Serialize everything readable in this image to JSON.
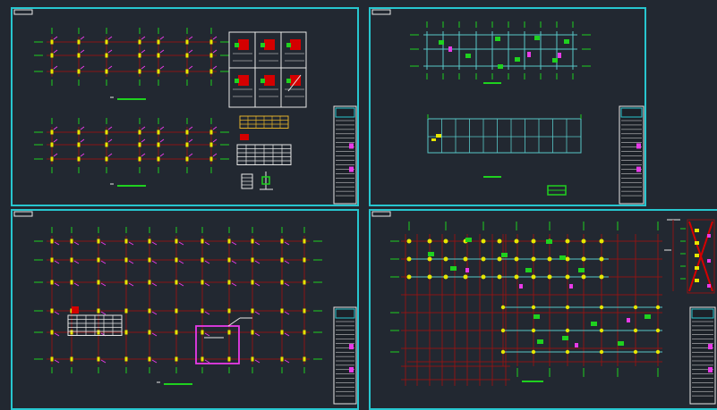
{
  "viewer": {
    "background": "#222831",
    "colors": {
      "frame": "#27c6cf",
      "grid_red": "#8b1515",
      "axis_green": "#1fd11f",
      "column_yellow": "#e6e600",
      "annotation_magenta": "#e83ae8",
      "fill_red": "#d40000",
      "table_white": "#e8e8e8",
      "plan_cyan": "#58c7c7",
      "table_orange": "#e3b12a"
    }
  },
  "sheets": [
    {
      "id": "sheet-top-left",
      "contents": [
        "column-layout-plan-a",
        "column-layout-plan-b",
        "column-detail-grid",
        "schedule-table-orange",
        "schedule-table-white",
        "legend"
      ]
    },
    {
      "id": "sheet-top-right",
      "contents": [
        "foundation-beam-plan",
        "outline-plan",
        "small-legend"
      ]
    },
    {
      "id": "sheet-bottom-left",
      "contents": [
        "column-grid-plan",
        "schedule-table",
        "detail-callout-magenta"
      ]
    },
    {
      "id": "sheet-bottom-right",
      "contents": [
        "roof-framing-plan",
        "section-strip"
      ]
    }
  ],
  "icons": [
    "title-block-icon",
    "sheet-tab-icon"
  ]
}
